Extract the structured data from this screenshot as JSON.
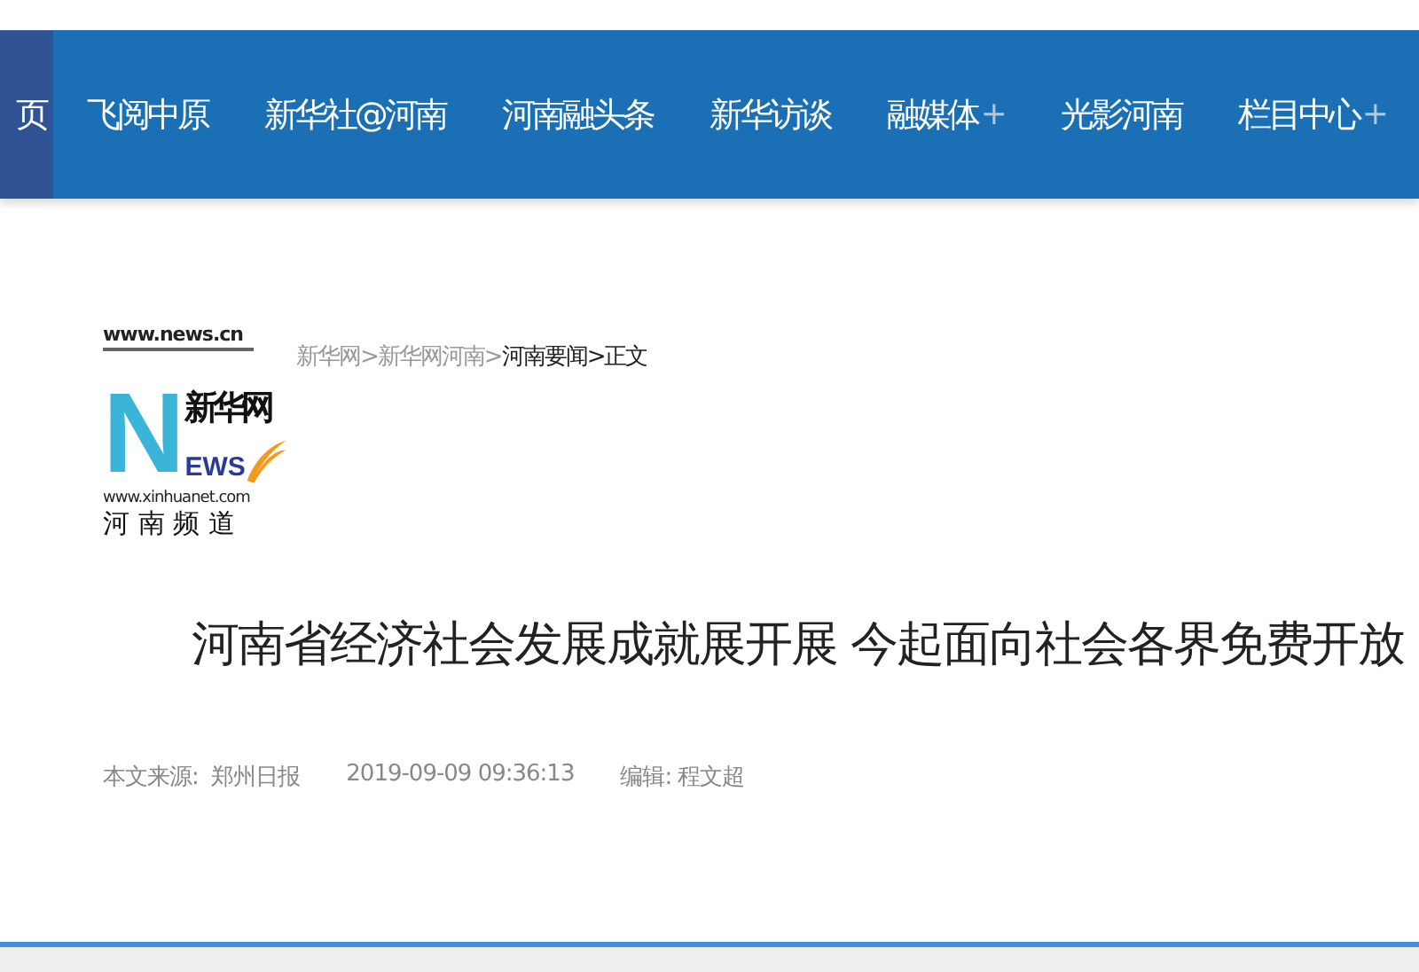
{
  "nav": {
    "items": [
      {
        "label": "页",
        "selected": true
      },
      {
        "label": "飞阅中原",
        "selected": false
      },
      {
        "label": "新华社@河南",
        "selected": false
      },
      {
        "label": "河南融头条",
        "selected": false
      },
      {
        "label": "新华访谈",
        "selected": false
      },
      {
        "label": "融媒体",
        "plus": "+",
        "selected": false
      },
      {
        "label": "光影河南",
        "selected": false
      },
      {
        "label": "栏目中心",
        "plus": "+",
        "selected": false
      }
    ]
  },
  "logo": {
    "domain": "www.news.cn",
    "brand": "新华网",
    "letter": "N",
    "word": "EWS",
    "site": "www.xinhuanet.com",
    "channel": "河 南 频 道"
  },
  "breadcrumb": [
    {
      "label": "新华网>",
      "current": false
    },
    {
      "label": "新华网河南>",
      "current": false
    },
    {
      "label": "河南要闻>",
      "current": true
    },
    {
      "label": "正文",
      "current": true
    }
  ],
  "article": {
    "title": "河南省经济社会发展成就展开展 今起面向社会各界免费开放",
    "source": "本文来源:  郑州日报",
    "time": "2019-09-09 09:36:13",
    "editor": "编辑: 程文超"
  }
}
